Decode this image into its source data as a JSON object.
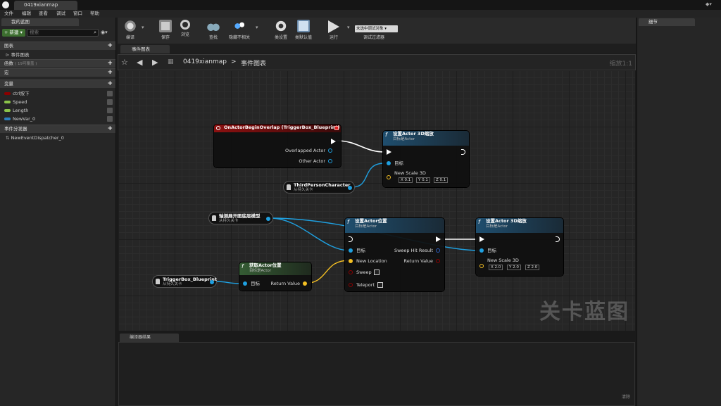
{
  "window": {
    "doc_tab": "0419xianmap"
  },
  "menu": [
    "文件",
    "编辑",
    "查看",
    "调试",
    "窗口",
    "帮助"
  ],
  "my_blueprint": {
    "tab": "我的蓝图",
    "new_button": "新建",
    "search_placeholder": "搜索",
    "sections": {
      "graphs": "图表",
      "event_graph": "事件图表",
      "functions": "函数",
      "functions_overridable": "( 19可覆盖 )",
      "macros": "宏",
      "variables": "变量",
      "event_dispatchers": "事件分发器"
    },
    "variables": [
      {
        "name": "ctrl按下",
        "color": "#8b0000"
      },
      {
        "name": "Speed",
        "color": "#8bc34a"
      },
      {
        "name": "Length",
        "color": "#8bc34a"
      },
      {
        "name": "NewVar_0",
        "color": "#2c7fbf"
      }
    ],
    "dispatchers": [
      "NewEventDispatcher_0"
    ]
  },
  "toolbar": {
    "compile": "编译",
    "save": "保存",
    "browse": "浏览",
    "find": "查找",
    "hide_unrelated": "隐藏不相关",
    "class_settings": "类设置",
    "class_defaults": "类默认值",
    "play": "运行",
    "debug_object": "未选中调试对象",
    "debug_filter": "调试过滤器"
  },
  "graph_tab": "事件图表",
  "breadcrumb": {
    "map": "0419xianmap",
    "graph": "事件图表",
    "zoom": "缩放1:1"
  },
  "watermark": "关卡蓝图",
  "nodes": {
    "overlap": {
      "title": "OnActorBeginOverlap (TriggerBox_Blueprint)",
      "pin1": "Overlapped Actor",
      "pin2": "Other Actor"
    },
    "scale1": {
      "title": "设置Actor 3D缩放",
      "sub": "目标是Actor",
      "target": "目标",
      "scale_label": "New Scale 3D",
      "x": "0.1",
      "y": "0.1",
      "z": "0.1"
    },
    "third_person": {
      "title": "ThirdPersonCharacter",
      "sub": "从持久关卡"
    },
    "model": {
      "title": "轴测展开图底层模型",
      "sub": "从持久关卡"
    },
    "set_location": {
      "title": "设置Actor位置",
      "sub": "目标是Actor",
      "target": "目标",
      "new_location": "New Location",
      "sweep": "Sweep",
      "teleport": "Teleport",
      "sweep_hit": "Sweep Hit Result",
      "return_value": "Return Value"
    },
    "scale2": {
      "title": "设置Actor 3D缩放",
      "sub": "目标是Actor",
      "target": "目标",
      "scale_label": "New Scale 3D",
      "x": "2.0",
      "y": "2.0",
      "z": "2.0"
    },
    "get_location": {
      "title": "获取Actor位置",
      "sub": "目标是Actor",
      "target": "目标",
      "return_value": "Return Value"
    },
    "trigger": {
      "title": "TriggerBox_Blueprint",
      "sub": "从持久关卡"
    }
  },
  "compiler": {
    "tab": "编译器结果",
    "clear": "清除"
  },
  "details": {
    "tab": "细节"
  },
  "colors": {
    "event_head": "#8c1010",
    "func_head": "#1f4e6e",
    "pure_head": "#355c34",
    "object_pin": "#1fa0e0",
    "vector_pin": "#f5c023",
    "bool_pin": "#8b0000"
  }
}
